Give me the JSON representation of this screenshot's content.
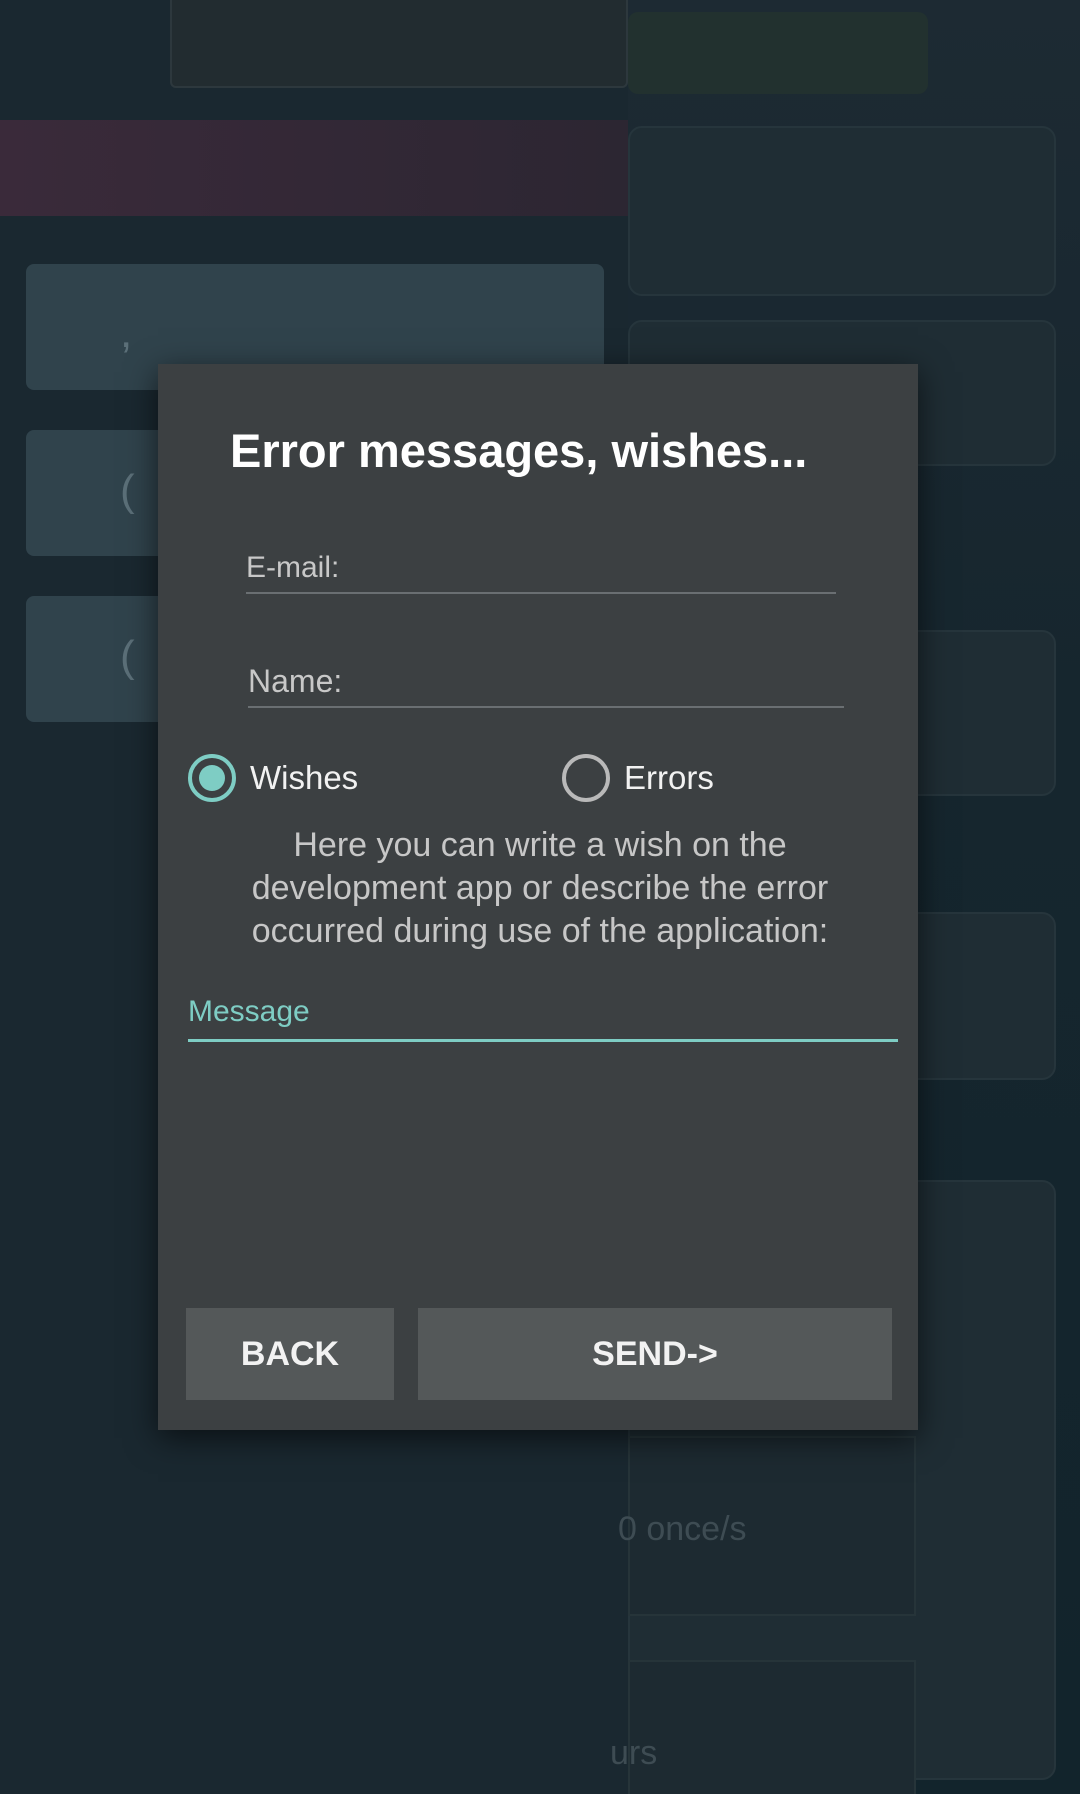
{
  "background": {
    "left_cards": [
      {
        "glyph": ","
      },
      {
        "glyph": "("
      },
      {
        "glyph": "("
      }
    ],
    "faint_texts": [
      {
        "text": "0 once/s"
      },
      {
        "text": "urs"
      }
    ]
  },
  "dialog": {
    "title": "Error messages, wishes...",
    "email": {
      "value": "",
      "placeholder": "E-mail:"
    },
    "name": {
      "value": "",
      "placeholder": "Name:"
    },
    "feedback_type": {
      "options": [
        {
          "label": "Wishes",
          "selected": true
        },
        {
          "label": "Errors",
          "selected": false
        }
      ]
    },
    "help_text": "Here you can write a wish on the development app or describe the error occurred during use of the application:",
    "message": {
      "value": "",
      "placeholder": "Message"
    },
    "buttons": {
      "back_label": "BACK",
      "send_label": "SEND->"
    }
  },
  "colors": {
    "accent": "#7ecdc4",
    "dialog_bg": "#3c4042",
    "button_bg": "#545859"
  }
}
